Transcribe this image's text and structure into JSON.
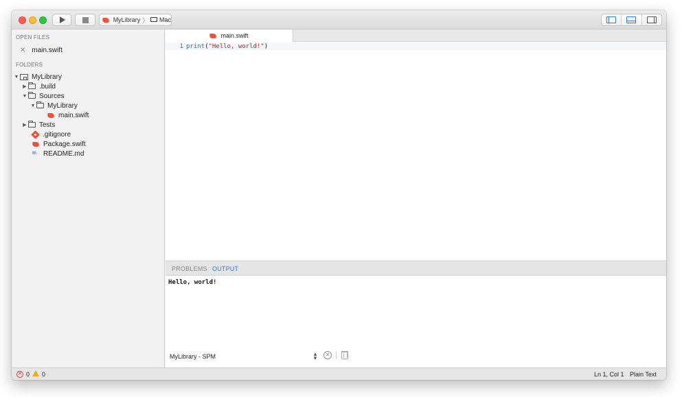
{
  "toolbar": {
    "scheme_target": "MyLibrary",
    "scheme_separator": "〉",
    "scheme_destination": "Mac"
  },
  "sidebar": {
    "open_files_header": "OPEN FILES",
    "open_files": [
      {
        "name": "main.swift"
      }
    ],
    "folders_header": "FOLDERS",
    "tree": [
      {
        "label": "MyLibrary",
        "type": "package",
        "expanded": true
      },
      {
        "label": ".build",
        "type": "folder",
        "expanded": false
      },
      {
        "label": "Sources",
        "type": "folder",
        "expanded": true
      },
      {
        "label": "MyLibrary",
        "type": "folder",
        "expanded": true
      },
      {
        "label": "main.swift",
        "type": "swift-file"
      },
      {
        "label": "Tests",
        "type": "folder",
        "expanded": false
      },
      {
        "label": ".gitignore",
        "type": "git-file"
      },
      {
        "label": "Package.swift",
        "type": "swift-file"
      },
      {
        "label": "README.md",
        "type": "markdown-file"
      }
    ]
  },
  "editor": {
    "tab_label": "main.swift",
    "line_number": "1",
    "code_keyword": "print",
    "code_open": "(",
    "code_string": "\"Hello, world!\"",
    "code_close": ")"
  },
  "panel": {
    "tab_problems": "PROBLEMS",
    "tab_output": "OUTPUT",
    "output_text": "Hello, world!",
    "target_selector": "MyLibrary - SPM"
  },
  "status": {
    "errors": "0",
    "warnings": "0",
    "cursor": "Ln 1, Col 1",
    "language": "Plain Text"
  },
  "colors": {
    "accent": "#2d7fd1",
    "swift": "#f05138",
    "error": "#d9393e",
    "warning": "#e8b00f"
  }
}
